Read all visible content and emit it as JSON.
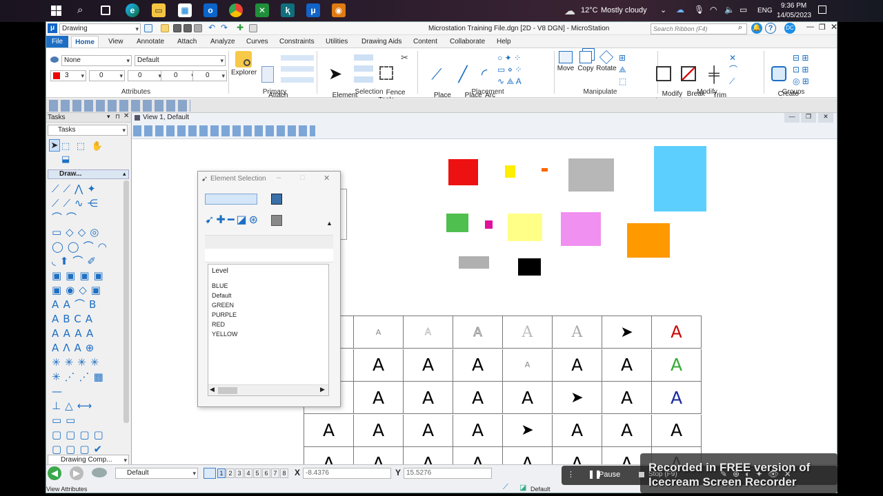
{
  "taskbar": {
    "weather_temp": "12°C",
    "weather_desc": "Mostly cloudy",
    "language": "ENG",
    "time": "9:36 PM",
    "date": "14/05/2023"
  },
  "window": {
    "workflow": "Drawing",
    "title": "Microstation Training File.dgn [2D - V8 DGN] - MicroStation",
    "search_placeholder": "Search Ribbon (F4)",
    "user_initials": "DC"
  },
  "ribbon": {
    "tabs": [
      "File",
      "Home",
      "View",
      "Annotate",
      "Attach",
      "Analyze",
      "Curves",
      "Constraints",
      "Utilities",
      "Drawing Aids",
      "Content",
      "Collaborate",
      "Help"
    ],
    "active_tab": "Home",
    "attributes": {
      "level": "None",
      "style": "Default",
      "color_num": "3",
      "weight": "0",
      "linestyle": "0",
      "class": "0",
      "transparency": "0",
      "priority": "0",
      "label": "Attributes"
    },
    "primary": {
      "explorer": "Explorer",
      "attach_tools": "Attach\nTools",
      "label": "Primary"
    },
    "selection": {
      "element_selection": "Element\nSelection",
      "fence_tools": "Fence\nTools",
      "label": "Selection"
    },
    "placement": {
      "place_smartline": "Place\nSmartLine",
      "place_line": "Place\nLine",
      "arc_tools": "Arc\nTools",
      "label": "Placement"
    },
    "manipulate": {
      "move": "Move",
      "copy": "Copy",
      "rotate": "Rotate",
      "label": "Manipulate"
    },
    "modify": {
      "modify_element": "Modify\nElement",
      "break_element": "Break\nElement",
      "trim_multiple": "Trim\nMultiple",
      "label": "Modify"
    },
    "groups": {
      "create_region": "Create\nRegion",
      "label": "Groups"
    }
  },
  "tasks_panel": {
    "title": "Tasks",
    "dropdown": "Tasks",
    "section": "Draw...",
    "bottom_dropdown": "Drawing Comp..."
  },
  "view": {
    "title": "View 1, Default",
    "squares": [
      {
        "color": "#ee1111"
      },
      {
        "color": "#ffee00"
      },
      {
        "color": "#ff6600"
      },
      {
        "color": "#b7b7b7"
      },
      {
        "color": "#5ccfff"
      },
      {
        "color": "#4fbf4f"
      },
      {
        "color": "#e0109a"
      },
      {
        "color": "#ffff88"
      },
      {
        "color": "#f090f0"
      },
      {
        "color": "#ff9900"
      },
      {
        "color": "#b0b0b0"
      },
      {
        "color": "#000000"
      }
    ],
    "grid_letter": "A"
  },
  "element_selection": {
    "title": "Element Selection",
    "list_header": "Level",
    "levels": [
      "BLUE",
      "Default",
      "GREEN",
      "PURPLE",
      "RED",
      "YELLOW"
    ]
  },
  "status": {
    "view_attributes": "View Attributes",
    "level_dropdown": "Default",
    "view_numbers": [
      "1",
      "2",
      "3",
      "4",
      "5",
      "6",
      "7",
      "8"
    ],
    "x_label": "X",
    "x_value": "-8.4376",
    "y_label": "Y",
    "y_value": "15.5276",
    "active_level": "Default"
  },
  "recorder": {
    "pause": "Pause",
    "stop": "Stop (F9)",
    "watermark": "Recorded in FREE version of Icecream Screen Recorder"
  }
}
